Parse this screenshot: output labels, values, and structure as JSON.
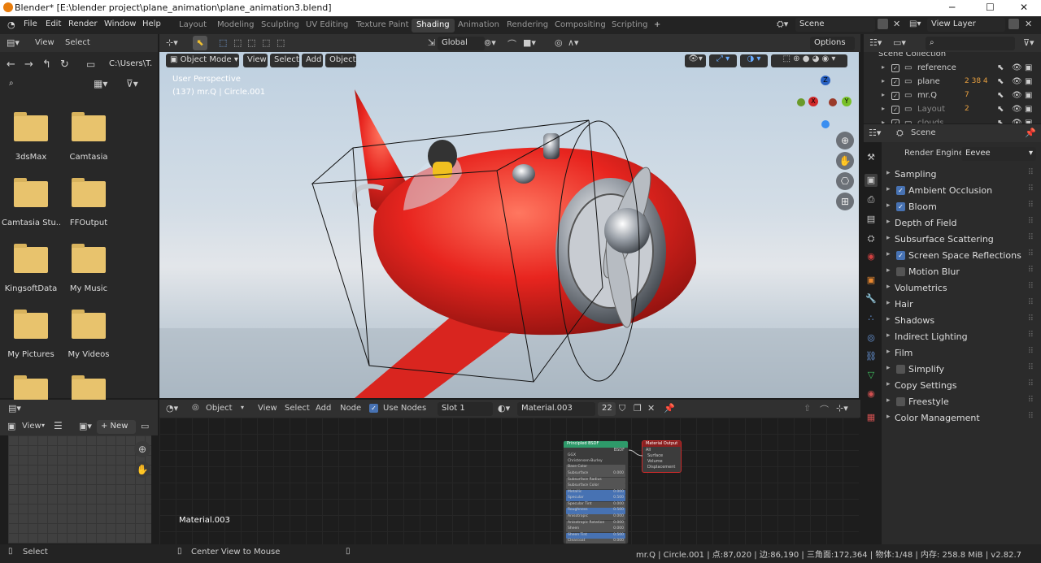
{
  "window": {
    "title": "Blender* [E:\\blender project\\plane_animation\\plane_animation3.blend]",
    "minimize": "─",
    "maximize": "☐",
    "close": "✕"
  },
  "menu": [
    "File",
    "Edit",
    "Render",
    "Window",
    "Help"
  ],
  "workspaces": [
    "Layout",
    "Modeling",
    "Sculpting",
    "UV Editing",
    "Texture Paint",
    "Shading",
    "Animation",
    "Rendering",
    "Compositing",
    "Scripting",
    "+"
  ],
  "scene": {
    "label": "Scene",
    "view_layer": "View Layer"
  },
  "filebrowser": {
    "view": "View",
    "select": "Select",
    "path": "C:\\Users\\T..",
    "folders": [
      "3dsMax",
      "Camtasia",
      "Camtasia Stu..",
      "FFOutput",
      "KingsoftData",
      "My Music",
      "My Pictures",
      "My Videos",
      "",
      ""
    ]
  },
  "viewport": {
    "mode": "Object Mode",
    "view": "View",
    "select": "Select",
    "add": "Add",
    "object": "Object",
    "orientation": "Global",
    "options": "Options",
    "perspective": "User Perspective",
    "object_info": "(137) mr.Q | Circle.001",
    "axis": {
      "x": "X",
      "y": "Y",
      "z": "Z"
    }
  },
  "image_editor": {
    "view": "View",
    "new": "+ New"
  },
  "node_editor": {
    "type": "Object",
    "view": "View",
    "select": "Select",
    "add": "Add",
    "node": "Node",
    "use_nodes": "Use Nodes",
    "slot": "Slot 1",
    "material": "Material.003",
    "users": "22",
    "material_label": "Material.003",
    "bsdf": {
      "title": "Principled BSDF",
      "out": "BSDF",
      "rows": [
        "GGX",
        "Christensen-Burley",
        "Base Color",
        "Subsurface",
        "Subsurface Radius",
        "Subsurface Color",
        "Metallic",
        "Specular",
        "Specular Tint",
        "Roughness",
        "Anisotropic",
        "Anisotropic Rotation",
        "Sheen",
        "Sheen Tint",
        "Clearcoat"
      ],
      "vals": [
        "",
        "",
        "",
        "0.000",
        "",
        "",
        "0.000",
        "0.500",
        "0.000",
        "0.500",
        "0.000",
        "0.000",
        "0.000",
        "0.500",
        "0.000"
      ]
    },
    "output": {
      "title": "Material Output",
      "target": "All",
      "sockets": [
        "Surface",
        "Volume",
        "Displacement"
      ]
    }
  },
  "outliner": {
    "title": "Scene Collection",
    "items": [
      "reference",
      "plane",
      "mr.Q",
      "Layout",
      "clouds"
    ],
    "badges": [
      "",
      "2 38 4",
      "7",
      "2",
      ""
    ]
  },
  "properties": {
    "scene": "Scene",
    "render_engine_label": "Render Engine",
    "render_engine": "Eevee",
    "sections": [
      {
        "label": "Sampling",
        "checkbox": false
      },
      {
        "label": "Ambient Occlusion",
        "checkbox": true,
        "on": true
      },
      {
        "label": "Bloom",
        "checkbox": true,
        "on": true
      },
      {
        "label": "Depth of Field",
        "checkbox": false
      },
      {
        "label": "Subsurface Scattering",
        "checkbox": false
      },
      {
        "label": "Screen Space Reflections",
        "checkbox": true,
        "on": true
      },
      {
        "label": "Motion Blur",
        "checkbox": true,
        "on": false
      },
      {
        "label": "Volumetrics",
        "checkbox": false
      },
      {
        "label": "Hair",
        "checkbox": false
      },
      {
        "label": "Shadows",
        "checkbox": false
      },
      {
        "label": "Indirect Lighting",
        "checkbox": false
      },
      {
        "label": "Film",
        "checkbox": false
      },
      {
        "label": "Simplify",
        "checkbox": true,
        "on": false
      },
      {
        "label": "Copy Settings",
        "checkbox": false
      },
      {
        "label": "Freestyle",
        "checkbox": true,
        "on": false
      },
      {
        "label": "Color Management",
        "checkbox": false
      }
    ]
  },
  "statusbar": {
    "left": "Select",
    "middle": "Center View to Mouse",
    "right": "mr.Q | Circle.001 | 点:87,020 | 边:86,190 | 三角面:172,364 | 物体:1/48 | 内存: 258.8 MiB | v2.82.7"
  },
  "colors": {
    "accent": "#4772b3",
    "plane_red": "#e8251f",
    "header": "#303030"
  }
}
